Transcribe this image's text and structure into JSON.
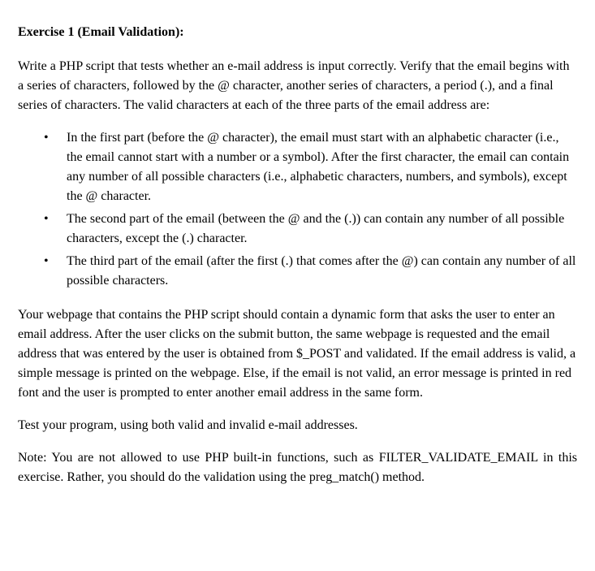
{
  "heading": "Exercise 1 (Email Validation):",
  "intro": "Write a PHP script that tests whether an e-mail address is input correctly. Verify that the email begins with a series of characters, followed by the @ character, another series of characters, a period (.), and a final series of characters. The valid characters at each of the three parts of the email address are:",
  "bullets": [
    "In the first part (before the @ character), the email must start with an alphabetic character (i.e., the email cannot start with a number or a symbol). After the first character, the email can contain any number of all possible characters (i.e., alphabetic characters, numbers, and symbols), except the @ character.",
    "The second part of the email (between the @ and the (.)) can contain any number of all possible characters, except the (.) character.",
    "The third part of the email (after the first (.) that comes after the @) can contain any number of all possible characters."
  ],
  "instructions": "Your webpage that contains the PHP script should contain a dynamic form that asks the user to enter an email address. After the user clicks on the submit button, the same webpage is requested and the email address that was entered by the user is obtained from $_POST and validated. If the email address is valid, a simple message is printed on the webpage. Else, if the email is not valid, an error message is printed in red font and the user is prompted to enter another email address in the same form.",
  "test": "Test your program, using both valid and invalid e-mail addresses.",
  "note": "Note: You are not allowed to use PHP built-in functions, such as FILTER_VALIDATE_EMAIL in this exercise. Rather, you should do the validation using the preg_match() method."
}
